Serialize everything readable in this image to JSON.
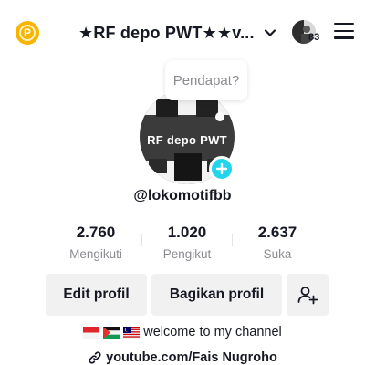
{
  "header": {
    "title": "★RF depo PWT★★v...",
    "notification_count": "83"
  },
  "bubble": {
    "text": "Pendapat?"
  },
  "profile": {
    "image_text": "RF depo PWT",
    "username": "@lokomotifbb"
  },
  "stats": [
    {
      "value": "2.760",
      "label": "Mengikuti"
    },
    {
      "value": "1.020",
      "label": "Pengikut"
    },
    {
      "value": "2.637",
      "label": "Suka"
    }
  ],
  "buttons": {
    "edit": "Edit profil",
    "share": "Bagikan profil"
  },
  "bio": {
    "text": "welcome to my channel",
    "flags": [
      "indonesia-flag",
      "palestine-flag",
      "malaysia-flag"
    ],
    "link": "youtube.com/Fais Nugroho"
  },
  "colors": {
    "accent": "#20d5ec",
    "coin": "#f7b500",
    "button_bg": "#f1f1f2",
    "secondary_text": "#8a8b91"
  },
  "icons": [
    "coin-icon",
    "chevron-down-icon",
    "menu-icon",
    "plus-icon",
    "add-friend-icon",
    "link-icon"
  ]
}
